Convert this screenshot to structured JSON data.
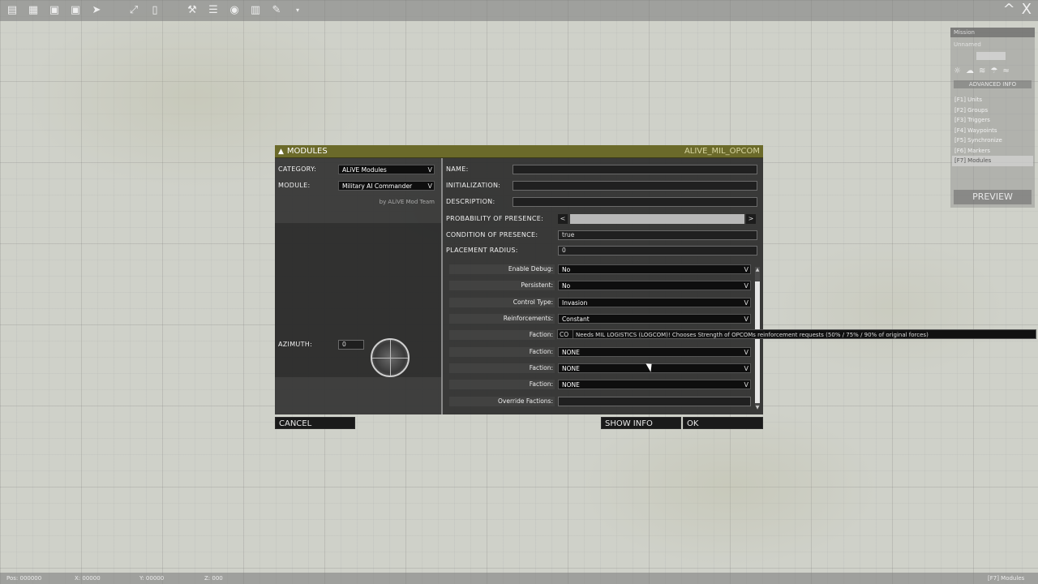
{
  "toolbar": {
    "icons": [
      "new-file-icon",
      "open-folder-icon",
      "save-icon",
      "save-as-icon",
      "export-icon",
      "expand-icon",
      "frame-icon",
      "tools-icon",
      "target-icon",
      "list-icon",
      "pencil-icon",
      "dropdown-icon"
    ]
  },
  "window": {
    "collapse": "^",
    "close": "X"
  },
  "right_panel": {
    "header": "Mission",
    "line1": "Unnamed",
    "advanced": "ADVANCED INFO",
    "items": [
      {
        "label": "[F1] Units"
      },
      {
        "label": "[F2] Groups"
      },
      {
        "label": "[F3] Triggers"
      },
      {
        "label": "[F4] Waypoints"
      },
      {
        "label": "[F5] Synchronize"
      },
      {
        "label": "[F6] Markers"
      },
      {
        "label": "[F7] Modules"
      }
    ],
    "preview": "PREVIEW"
  },
  "statusbar": {
    "left": "Pos: 000000",
    "x": "X: 00000",
    "y": "Y: 00000",
    "z": "Z: 000",
    "right": "[F7] Modules"
  },
  "dialog": {
    "title": "MODULES",
    "module_id": "ALIVE_MIL_OPCOM",
    "category_label": "CATEGORY:",
    "category_value": "ALiVE Modules",
    "module_label": "MODULE:",
    "module_value": "Military AI Commander",
    "credit": "by ALiVE Mod Team",
    "azimuth_label": "AZIMUTH:",
    "azimuth_value": "0",
    "name_label": "NAME:",
    "init_label": "INITIALIZATION:",
    "desc_label": "DESCRIPTION:",
    "prob_label": "PROBABILITY OF PRESENCE:",
    "cond_label": "CONDITION OF PRESENCE:",
    "cond_value": "true",
    "radius_label": "PLACEMENT RADIUS:",
    "radius_value": "0",
    "params": [
      {
        "label": "Enable Debug:",
        "value": "No"
      },
      {
        "label": "Persistent:",
        "value": "No"
      },
      {
        "label": "Control Type:",
        "value": "Invasion"
      },
      {
        "label": "Reinforcements:",
        "value": "Constant"
      }
    ],
    "faction_label": "Faction:",
    "faction_first": "CO",
    "factions": [
      {
        "label": "Faction:",
        "value": "NONE"
      },
      {
        "label": "Faction:",
        "value": "NONE"
      },
      {
        "label": "Faction:",
        "value": "NONE"
      }
    ],
    "override_label": "Override Factions:",
    "tooltip": "Needs MIL LOGISTICS (LOGCOM)! Chooses Strength of OPCOMs reinforcement requests (50% / 75% / 90% of original forces)",
    "cancel": "CANCEL",
    "show_info": "SHOW INFO",
    "ok": "OK"
  }
}
